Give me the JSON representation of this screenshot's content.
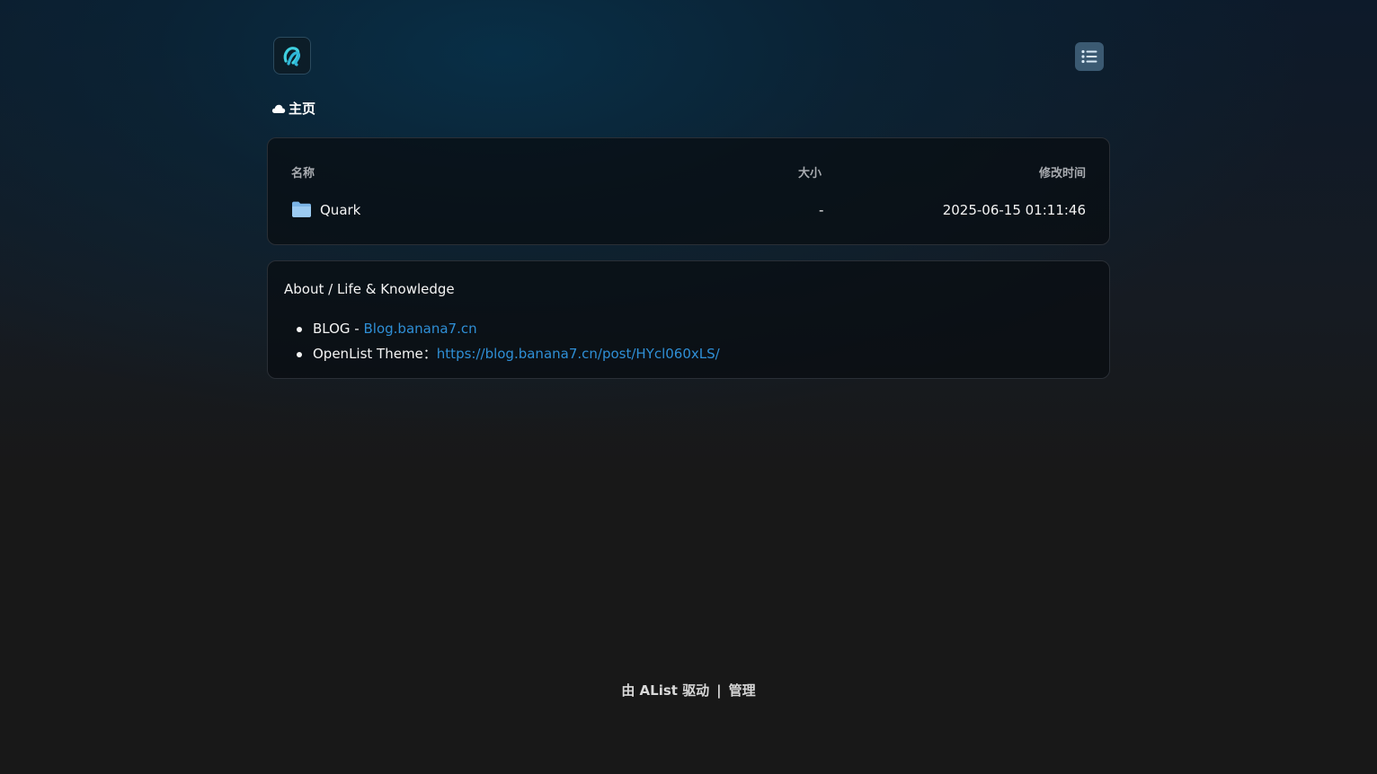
{
  "header": {
    "logo_icon": "alist-logo-icon",
    "menu_icon": "list-menu-icon"
  },
  "breadcrumb": {
    "icon": "cloud-icon",
    "label": "主页"
  },
  "file_table": {
    "columns": {
      "name": "名称",
      "size": "大小",
      "modified": "修改时间"
    },
    "rows": [
      {
        "icon": "folder-icon",
        "name": "Quark",
        "size": "-",
        "modified": "2025-06-15 01:11:46"
      }
    ]
  },
  "readme": {
    "title": "About / Life & Knowledge",
    "items": [
      {
        "label": "BLOG - ",
        "link_text": "Blog.banana7.cn"
      },
      {
        "label": "OpenList Theme：",
        "link_text": "https://blog.banana7.cn/post/HYcl060xLS/"
      }
    ]
  },
  "footer": {
    "powered_by": "由 AList 驱动",
    "separator": "|",
    "admin": "管理"
  },
  "colors": {
    "accent_link": "#2f8fd6",
    "folder": "#8cc3ee",
    "menu_button": "#3b5a72"
  }
}
